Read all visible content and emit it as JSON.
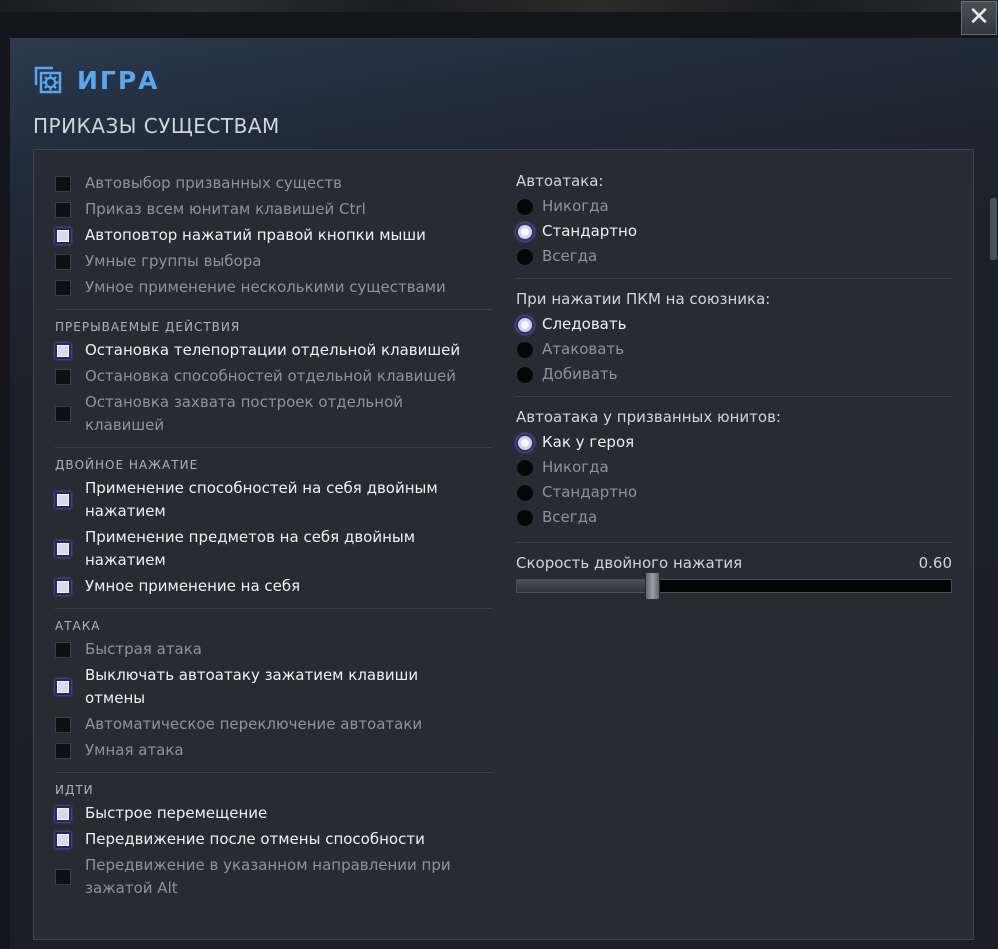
{
  "header": {
    "title": "ИГРА",
    "section_title": "ПРИКАЗЫ СУЩЕСТВАМ",
    "close_label": "✕"
  },
  "colors": {
    "accent": "#5aa7ee",
    "panel_bg": "#272c32",
    "text_enabled": "#eef1f4",
    "text_disabled": "#8c939b"
  },
  "icons": {
    "header": "game-settings-icon",
    "close": "close-icon"
  },
  "left": {
    "general": [
      {
        "label": "Автовыбор призванных существ",
        "checked": false
      },
      {
        "label": "Приказ всем юнитам клавишей Ctrl",
        "checked": false
      },
      {
        "label": "Автоповтор нажатий правой кнопки мыши",
        "checked": true
      },
      {
        "label": "Умные группы выбора",
        "checked": false
      },
      {
        "label": "Умное применение несколькими существами",
        "checked": false
      }
    ],
    "interruptible": {
      "label": "ПРЕРЫВАЕМЫЕ ДЕЙСТВИЯ",
      "items": [
        {
          "label": "Остановка телепортации отдельной клавишей",
          "checked": true
        },
        {
          "label": "Остановка способностей отдельной клавишей",
          "checked": false
        },
        {
          "label": "Остановка захвата построек отдельной клавишей",
          "checked": false
        }
      ]
    },
    "double_tap": {
      "label": "ДВОЙНОЕ НАЖАТИЕ",
      "items": [
        {
          "label": "Применение способностей на себя двойным нажатием",
          "checked": true
        },
        {
          "label": "Применение предметов на себя двойным нажатием",
          "checked": true
        },
        {
          "label": "Умное применение на себя",
          "checked": true
        }
      ]
    },
    "attack": {
      "label": "АТАКА",
      "items": [
        {
          "label": "Быстрая атака",
          "checked": false
        },
        {
          "label": "Выключать автоатаку зажатием клавиши отмены",
          "checked": true
        },
        {
          "label": "Автоматическое переключение автоатаки",
          "checked": false
        },
        {
          "label": "Умная атака",
          "checked": false
        }
      ]
    },
    "move": {
      "label": "ИДТИ",
      "items": [
        {
          "label": "Быстрое перемещение",
          "checked": true
        },
        {
          "label": "Передвижение после отмены способности",
          "checked": true
        },
        {
          "label": "Передвижение в указанном направлении при зажатой Alt",
          "checked": false
        }
      ]
    }
  },
  "right": {
    "autoattack": {
      "title": "Автоатака:",
      "options": [
        {
          "label": "Никогда",
          "selected": false
        },
        {
          "label": "Стандартно",
          "selected": true
        },
        {
          "label": "Всегда",
          "selected": false
        }
      ]
    },
    "rmb_ally": {
      "title": "При нажатии ПКМ на союзника:",
      "options": [
        {
          "label": "Следовать",
          "selected": true
        },
        {
          "label": "Атаковать",
          "selected": false
        },
        {
          "label": "Добивать",
          "selected": false
        }
      ]
    },
    "summon_autoattack": {
      "title": "Автоатака у призванных юнитов:",
      "options": [
        {
          "label": "Как у героя",
          "selected": true
        },
        {
          "label": "Никогда",
          "selected": false
        },
        {
          "label": "Стандартно",
          "selected": false
        },
        {
          "label": "Всегда",
          "selected": false
        }
      ]
    },
    "double_tap_speed": {
      "label": "Скорость двойного нажатия",
      "value_text": "0.60",
      "fraction": 0.31
    }
  }
}
